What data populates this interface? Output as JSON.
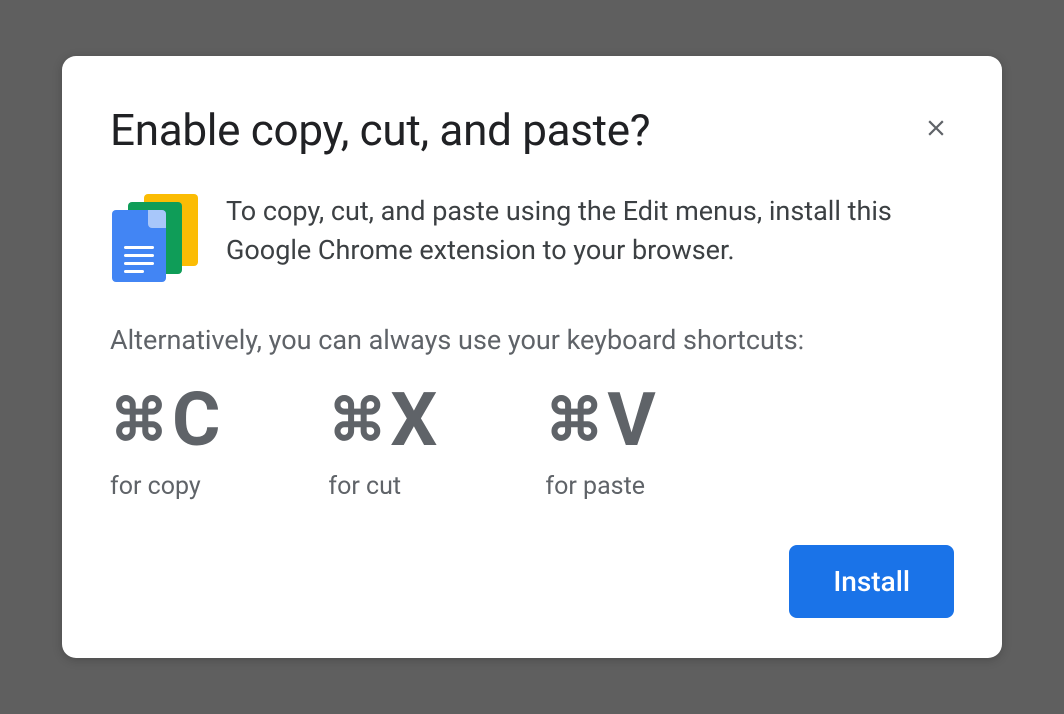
{
  "dialog": {
    "title": "Enable copy, cut, and paste?",
    "intro": "To copy, cut, and paste using the Edit menus, install this Google Chrome extension to your browser.",
    "alt": "Alternatively, you can always use your keyboard shortcuts:",
    "shortcuts": [
      {
        "modifier": "⌘",
        "key": "C",
        "label": "for copy"
      },
      {
        "modifier": "⌘",
        "key": "X",
        "label": "for cut"
      },
      {
        "modifier": "⌘",
        "key": "V",
        "label": "for paste"
      }
    ],
    "install": "Install"
  }
}
